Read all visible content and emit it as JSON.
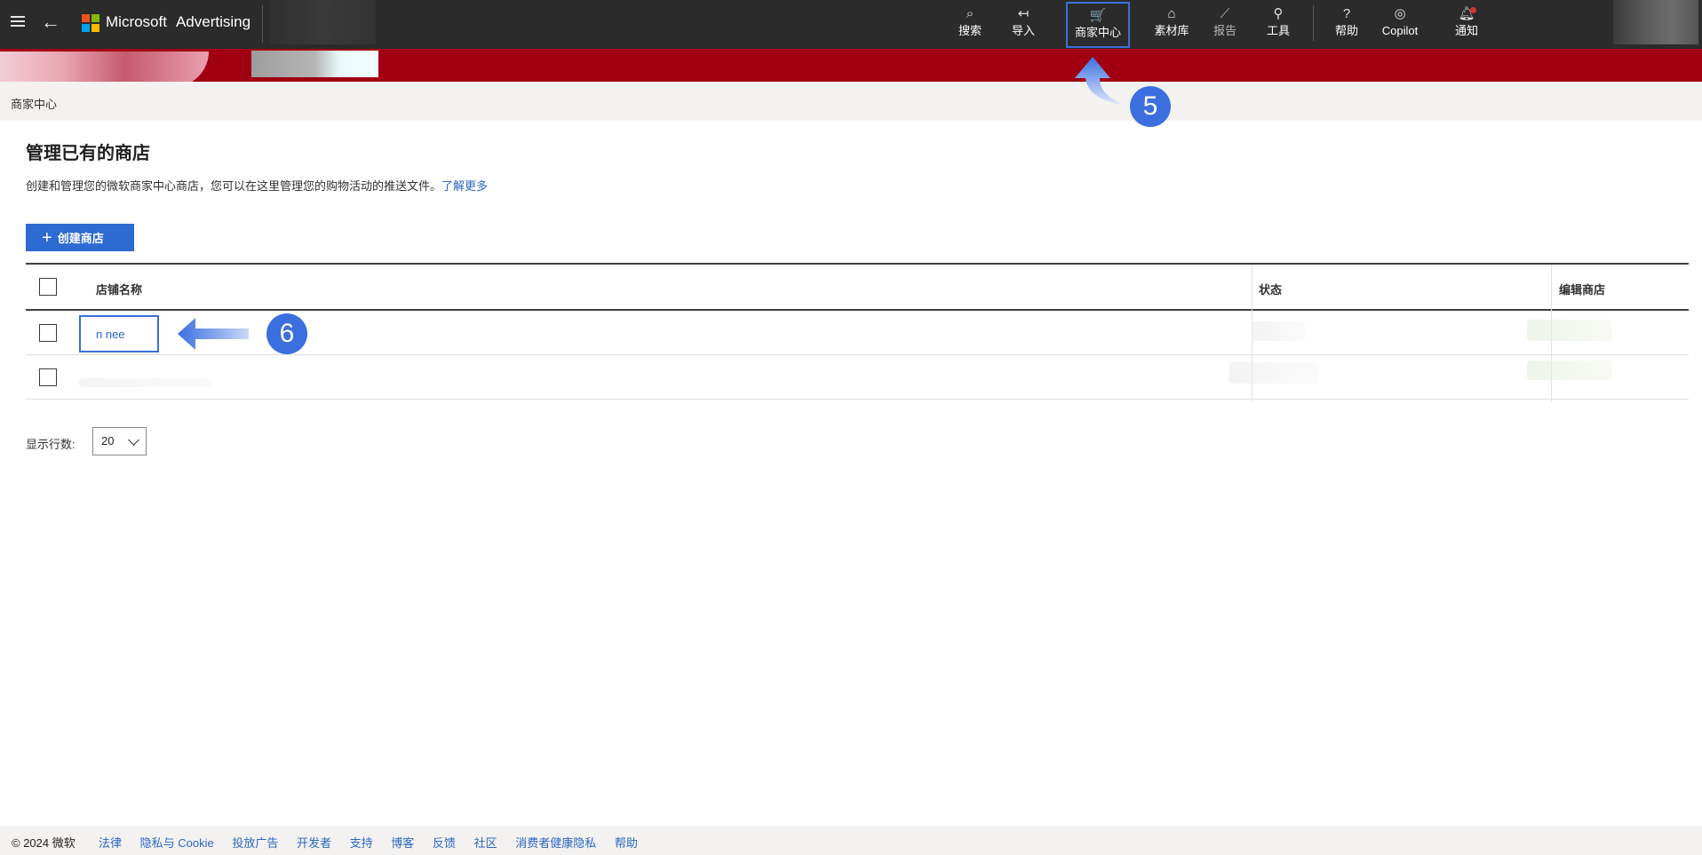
{
  "header": {
    "brand_name": "Microsoft",
    "product_name": "Advertising",
    "nav": [
      {
        "label": "搜索",
        "icon": "search-icon"
      },
      {
        "label": "导入",
        "icon": "import-icon"
      },
      {
        "label": "商家中心",
        "icon": "cart-icon"
      },
      {
        "label": "素材库",
        "icon": "tag-icon"
      },
      {
        "label": "报告",
        "icon": "chart-icon"
      },
      {
        "label": "工具",
        "icon": "wrench-icon"
      },
      {
        "label": "帮助",
        "icon": "help-icon"
      },
      {
        "label": "Copilot",
        "icon": "copilot-icon"
      },
      {
        "label": "通知",
        "icon": "bell-icon"
      }
    ]
  },
  "breadcrumb": "商家中心",
  "callouts": [
    "5",
    "6"
  ],
  "main": {
    "title": "管理已有的商店",
    "description": "创建和管理您的微软商家中心商店，您可以在这里管理您的购物活动的推送文件。",
    "learn_more": "了解更多",
    "create_button": "创建商店"
  },
  "table": {
    "columns": [
      "店铺名称",
      "状态",
      "编辑商店"
    ],
    "rows": [
      {
        "name": "n     nee"
      },
      {
        "name": ""
      }
    ]
  },
  "pagination": {
    "rows_label": "显示行数:",
    "rows_value": "20"
  },
  "footer": {
    "copyright": "© 2024 微软",
    "links": [
      "法律",
      "隐私与 Cookie",
      "投放广告",
      "开发者",
      "支持",
      "博客",
      "反馈",
      "社区",
      "消费者健康隐私",
      "帮助"
    ]
  },
  "colors": {
    "topbar": "#2b2b2b",
    "banner": "#a10013",
    "accent": "#2d6ad1",
    "callout": "#3b6fe0"
  }
}
